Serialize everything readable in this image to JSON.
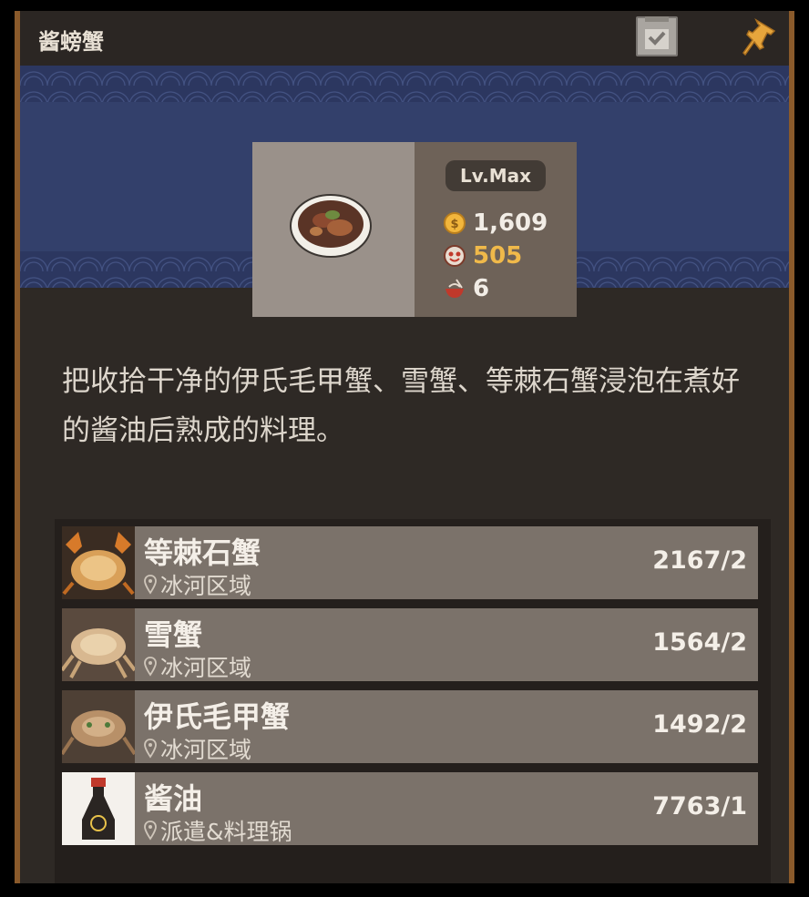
{
  "window": {
    "title": "酱螃蟹"
  },
  "dish": {
    "level": "Lv.Max",
    "price": "1,609",
    "taste": "505",
    "portion": "6"
  },
  "description": "把收拾干净的伊氏毛甲蟹、雪蟹、等棘石蟹浸泡在煮好的酱油后熟成的料理。",
  "ingredients": [
    {
      "name": "等棘石蟹",
      "location": "冰河区域",
      "count": "2167/2"
    },
    {
      "name": "雪蟹",
      "location": "冰河区域",
      "count": "1564/2"
    },
    {
      "name": "伊氏毛甲蟹",
      "location": "冰河区域",
      "count": "1492/2"
    },
    {
      "name": "酱油",
      "location": "派遣&料理锅",
      "count": "7763/1"
    }
  ],
  "colors": {
    "frame": "#8a5a2b",
    "panel": "#2e2925",
    "banner": "#33406b",
    "taste": "#f0b94a"
  },
  "icons": {
    "collect": "collection-check-icon",
    "pin": "pin-icon",
    "coin": "coin-icon",
    "taste": "taste-icon",
    "portion": "bowl-icon",
    "location": "location-pin-icon"
  }
}
